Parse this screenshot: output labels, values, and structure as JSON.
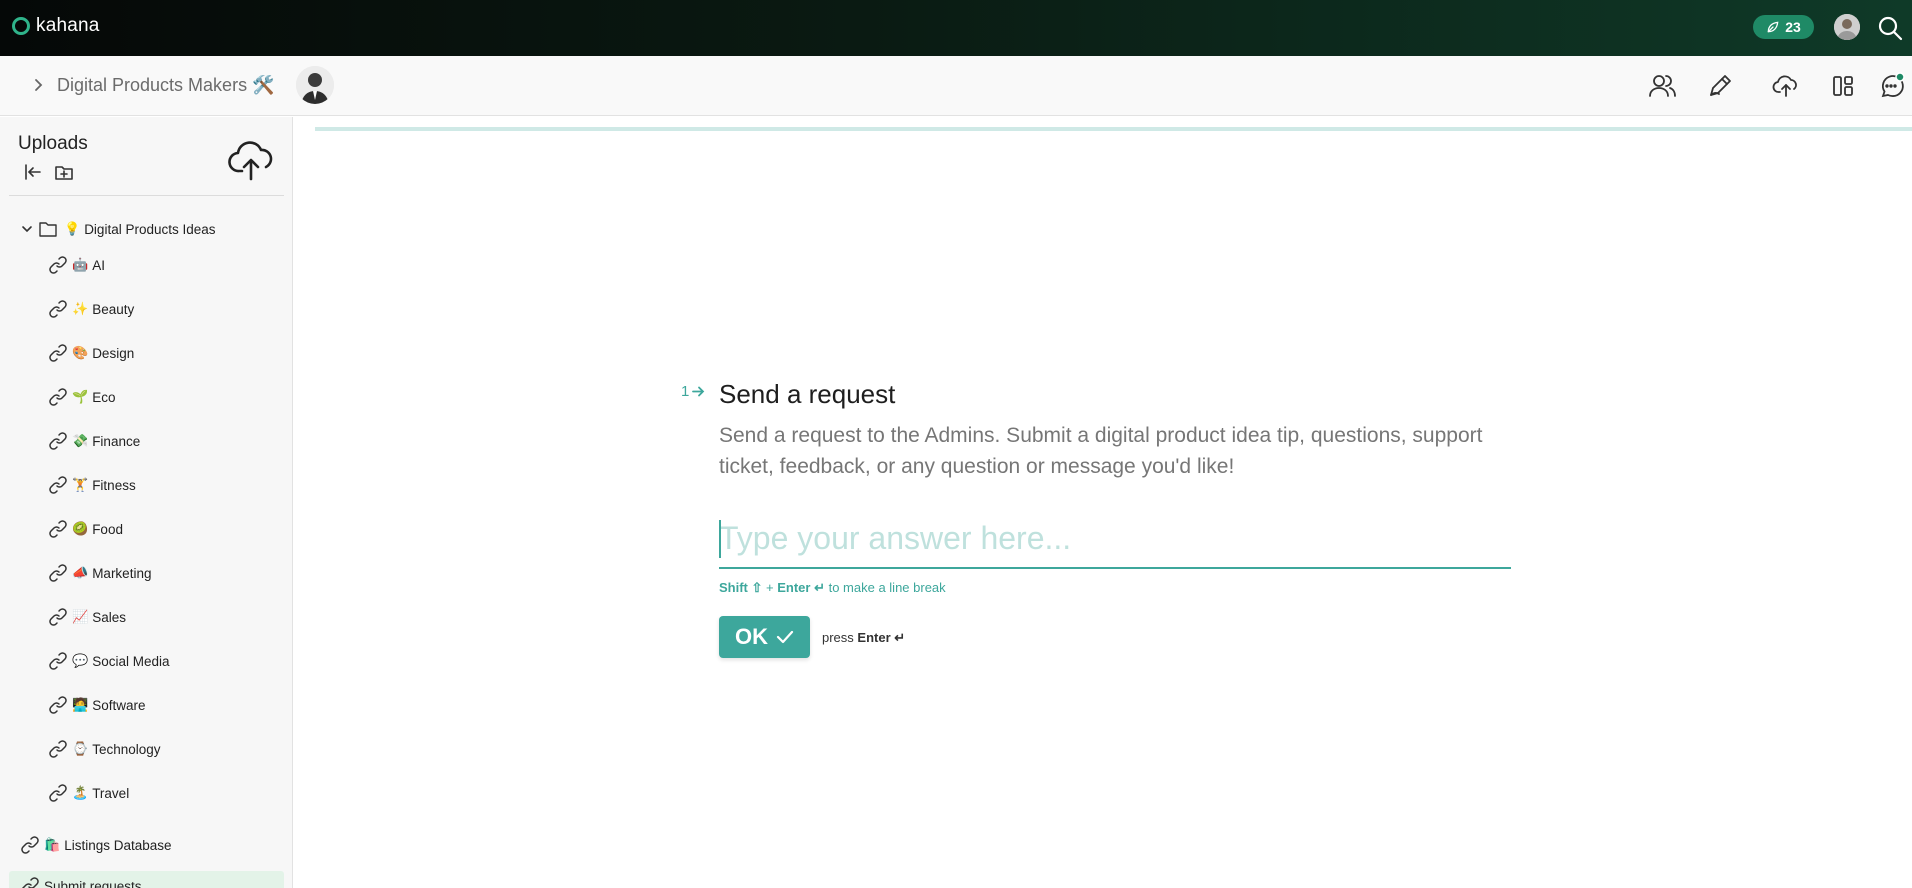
{
  "app": {
    "name": "kahana",
    "notification_count": "23",
    "accent": "#3da79c"
  },
  "header": {
    "title": "Digital Products Makers 🛠️"
  },
  "sidebar": {
    "title": "Uploads",
    "folder": {
      "emoji": "💡",
      "label": "Digital Products Ideas"
    },
    "items": [
      {
        "emoji": "🤖",
        "label": "AI"
      },
      {
        "emoji": "✨",
        "label": "Beauty"
      },
      {
        "emoji": "🎨",
        "label": "Design"
      },
      {
        "emoji": "🌱",
        "label": "Eco"
      },
      {
        "emoji": "💸",
        "label": "Finance"
      },
      {
        "emoji": "🏋️",
        "label": "Fitness"
      },
      {
        "emoji": "🥝",
        "label": "Food"
      },
      {
        "emoji": "📣",
        "label": "Marketing"
      },
      {
        "emoji": "📈",
        "label": "Sales"
      },
      {
        "emoji": "💬",
        "label": "Social Media"
      },
      {
        "emoji": "🧑‍💻",
        "label": "Software"
      },
      {
        "emoji": "⌚",
        "label": "Technology"
      },
      {
        "emoji": "🏝️",
        "label": "Travel"
      }
    ],
    "listings": {
      "emoji": "🛍️",
      "label": "Listings Database"
    },
    "submit": {
      "label": "Submit requests"
    }
  },
  "form": {
    "question_number": "1",
    "question_title": "Send a request",
    "description": "Send a request to the Admins. Submit a digital product idea tip, questions, support ticket, feedback, or any question or message you'd like!",
    "answer_placeholder": "Type your answer here...",
    "answer_value": "",
    "hint_shift": "Shift ⇧",
    "hint_plus": "+",
    "hint_enter": "Enter ↵",
    "hint_text": "to make a line break",
    "ok_label": "OK",
    "press_text": "press",
    "press_key": "Enter ↵"
  }
}
